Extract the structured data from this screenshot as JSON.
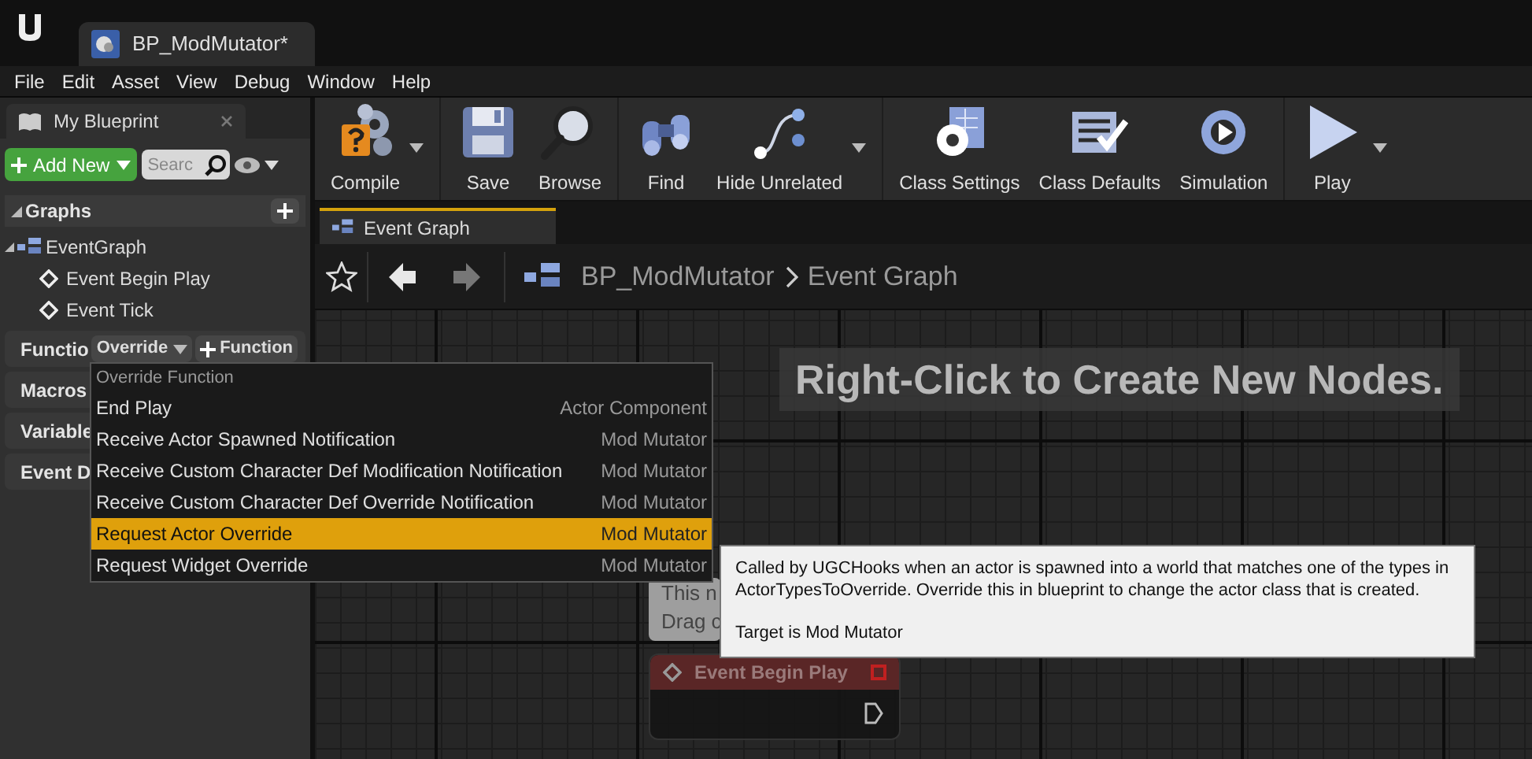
{
  "app_tab": {
    "title": "BP_ModMutator*"
  },
  "menu_bar": [
    "File",
    "Edit",
    "Asset",
    "View",
    "Debug",
    "Window",
    "Help"
  ],
  "my_blueprint": {
    "tab": "My Blueprint",
    "add_new": "Add New",
    "search": {
      "placeholder": "Searc"
    },
    "graphs": {
      "label": "Graphs",
      "expanded": true,
      "children": [
        {
          "label": "EventGraph",
          "kind": "graph",
          "expanded": true,
          "children": [
            {
              "label": "Event Begin Play",
              "kind": "event"
            },
            {
              "label": "Event Tick",
              "kind": "event"
            }
          ]
        }
      ]
    },
    "sections": [
      {
        "label": "Functio"
      },
      {
        "label": "Macros"
      },
      {
        "label": "Variable"
      },
      {
        "label": "Event D"
      }
    ],
    "override_button": "Override",
    "function_button": "Function"
  },
  "toolbar": [
    {
      "items": [
        {
          "label": "Compile",
          "kind": "compile",
          "dropdown": true
        }
      ]
    },
    {
      "items": [
        {
          "label": "Save",
          "kind": "save",
          "dropdown": false
        },
        {
          "label": "Browse",
          "kind": "browse",
          "dropdown": false
        }
      ]
    },
    {
      "items": [
        {
          "label": "Find",
          "kind": "find",
          "dropdown": false
        },
        {
          "label": "Hide Unrelated",
          "kind": "hide",
          "dropdown": true
        }
      ]
    },
    {
      "items": [
        {
          "label": "Class Settings",
          "kind": "settings",
          "dropdown": false
        },
        {
          "label": "Class Defaults",
          "kind": "defaults",
          "dropdown": false
        },
        {
          "label": "Simulation",
          "kind": "simulation",
          "dropdown": false
        }
      ]
    },
    {
      "items": [
        {
          "label": "Play",
          "kind": "play",
          "dropdown": true
        }
      ]
    }
  ],
  "graph_tab": {
    "title": "Event Graph"
  },
  "breadcrumb": [
    "BP_ModMutator",
    "Event Graph"
  ],
  "canvas_hint": "Right-Click to Create New Nodes.",
  "comment_bubble": [
    "This n",
    "Drag c"
  ],
  "node": {
    "title": "Event Begin Play"
  },
  "override_menu": {
    "header": "Override Function",
    "items": [
      {
        "name": "End Play",
        "category": "Actor Component",
        "selected": false
      },
      {
        "name": "Receive Actor Spawned Notification",
        "category": "Mod Mutator",
        "selected": false
      },
      {
        "name": "Receive Custom Character Def Modification Notification",
        "category": "Mod Mutator",
        "selected": false
      },
      {
        "name": "Receive Custom Character Def Override Notification",
        "category": "Mod Mutator",
        "selected": false
      },
      {
        "name": "Request Actor Override",
        "category": "Mod Mutator",
        "selected": true
      },
      {
        "name": "Request Widget Override",
        "category": "Mod Mutator",
        "selected": false
      }
    ]
  },
  "tooltip": {
    "description": "Called by UGCHooks when an actor is spawned into a world that matches one of the types in\nActorTypesToOverride.  Override this in blueprint to change the actor class that is created.",
    "target": "Target is Mod Mutator"
  }
}
